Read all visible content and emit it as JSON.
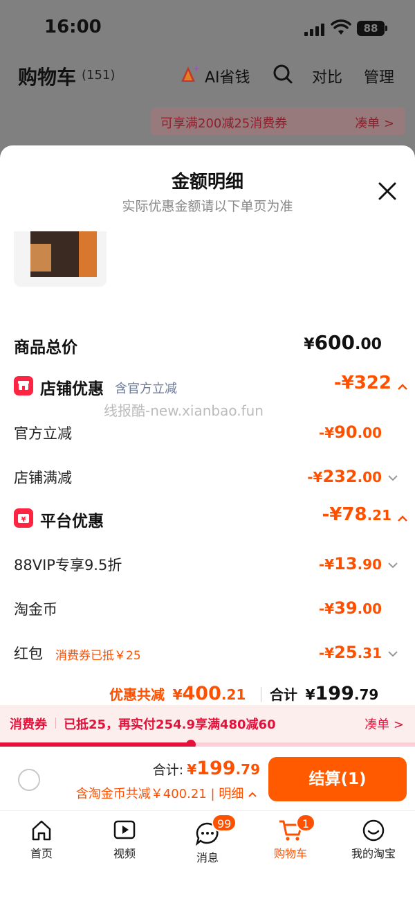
{
  "status_bar": {
    "time": "16:00",
    "battery": "88"
  },
  "cart_header": {
    "title": "购物车",
    "count": "(151)",
    "ai_label": "AI省钱",
    "compare_label": "对比",
    "manage_label": "管理"
  },
  "coupon_banner": {
    "text": "可享满200减25消费券",
    "action": "凑单 >"
  },
  "sheet": {
    "title": "金额明细",
    "subtitle": "实际优惠金额请以下单页为准",
    "watermark": "线报酷-new.xianbao.fun",
    "total_price": {
      "label": "商品总价",
      "yen": "¥",
      "int": "600",
      "dec": ".00"
    },
    "store_discount": {
      "label": "店铺优惠",
      "note": "含官方立减",
      "amount": {
        "prefix": "-¥",
        "int": "322",
        "dec": ""
      },
      "items": [
        {
          "label": "官方立减",
          "prefix": "-¥",
          "int": "90",
          "dec": ".00"
        },
        {
          "label": "店铺满减",
          "prefix": "-¥",
          "int": "232",
          "dec": ".00"
        }
      ]
    },
    "platform_discount": {
      "label": "平台优惠",
      "amount": {
        "prefix": "-¥",
        "int": "78",
        "dec": ".21"
      },
      "items": [
        {
          "label": "88VIP专享9.5折",
          "prefix": "-¥",
          "int": "13",
          "dec": ".90"
        },
        {
          "label": "淘金币",
          "prefix": "-¥",
          "int": "39",
          "dec": ".00"
        },
        {
          "label": "红包",
          "tag": "消费券已抵￥25",
          "prefix": "-¥",
          "int": "25",
          "dec": ".31"
        }
      ]
    },
    "summary": {
      "discount_label": "优惠共减",
      "discount_yen": "¥",
      "discount_int": "400",
      "discount_dec": ".21",
      "total_label": "合计",
      "total_yen": "¥",
      "total_int": "199",
      "total_dec": ".79"
    }
  },
  "promo_strip": {
    "tag": "消费券",
    "text": "已抵25，再实付254.9享满480减60",
    "action": "凑单 >",
    "progress": 0.46
  },
  "checkout": {
    "total_label": "合计:",
    "total_yen": "¥",
    "total_int": "199",
    "total_dec": ".79",
    "coin_line": "含淘金币共减￥400.21 | 明细",
    "pay_button": "结算(1)"
  },
  "tabbar": {
    "tabs": [
      {
        "label": "首页",
        "icon": "home-icon"
      },
      {
        "label": "视频",
        "icon": "video-icon"
      },
      {
        "label": "消息",
        "icon": "message-icon",
        "badge": "99"
      },
      {
        "label": "购物车",
        "icon": "cart-icon",
        "badge": "1",
        "active": true
      },
      {
        "label": "我的淘宝",
        "icon": "profile-icon"
      }
    ]
  },
  "colors": {
    "accent": "#ff5000",
    "red": "#e4123a",
    "tag_red": "#ff2442"
  }
}
